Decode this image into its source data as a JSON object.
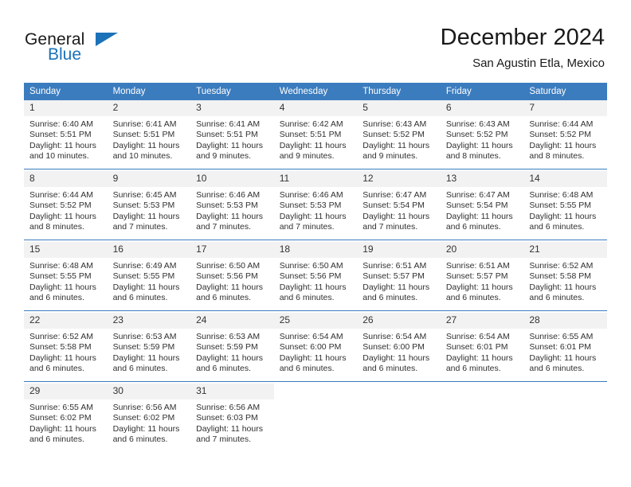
{
  "brand": {
    "word_one": "General",
    "word_two": "Blue",
    "logo_icon": "triangle-flag-icon"
  },
  "header": {
    "month_title": "December 2024",
    "location": "San Agustin Etla, Mexico"
  },
  "colors": {
    "header_blue": "#3b7cbe",
    "brand_blue": "#1b72b8",
    "daynum_bg": "#f2f2f2",
    "text": "#303030"
  },
  "calendar": {
    "weekday_headers": [
      "Sunday",
      "Monday",
      "Tuesday",
      "Wednesday",
      "Thursday",
      "Friday",
      "Saturday"
    ],
    "weeks": [
      [
        {
          "day": "1",
          "sunrise": "Sunrise: 6:40 AM",
          "sunset": "Sunset: 5:51 PM",
          "daylight": "Daylight: 11 hours and 10 minutes."
        },
        {
          "day": "2",
          "sunrise": "Sunrise: 6:41 AM",
          "sunset": "Sunset: 5:51 PM",
          "daylight": "Daylight: 11 hours and 10 minutes."
        },
        {
          "day": "3",
          "sunrise": "Sunrise: 6:41 AM",
          "sunset": "Sunset: 5:51 PM",
          "daylight": "Daylight: 11 hours and 9 minutes."
        },
        {
          "day": "4",
          "sunrise": "Sunrise: 6:42 AM",
          "sunset": "Sunset: 5:51 PM",
          "daylight": "Daylight: 11 hours and 9 minutes."
        },
        {
          "day": "5",
          "sunrise": "Sunrise: 6:43 AM",
          "sunset": "Sunset: 5:52 PM",
          "daylight": "Daylight: 11 hours and 9 minutes."
        },
        {
          "day": "6",
          "sunrise": "Sunrise: 6:43 AM",
          "sunset": "Sunset: 5:52 PM",
          "daylight": "Daylight: 11 hours and 8 minutes."
        },
        {
          "day": "7",
          "sunrise": "Sunrise: 6:44 AM",
          "sunset": "Sunset: 5:52 PM",
          "daylight": "Daylight: 11 hours and 8 minutes."
        }
      ],
      [
        {
          "day": "8",
          "sunrise": "Sunrise: 6:44 AM",
          "sunset": "Sunset: 5:52 PM",
          "daylight": "Daylight: 11 hours and 8 minutes."
        },
        {
          "day": "9",
          "sunrise": "Sunrise: 6:45 AM",
          "sunset": "Sunset: 5:53 PM",
          "daylight": "Daylight: 11 hours and 7 minutes."
        },
        {
          "day": "10",
          "sunrise": "Sunrise: 6:46 AM",
          "sunset": "Sunset: 5:53 PM",
          "daylight": "Daylight: 11 hours and 7 minutes."
        },
        {
          "day": "11",
          "sunrise": "Sunrise: 6:46 AM",
          "sunset": "Sunset: 5:53 PM",
          "daylight": "Daylight: 11 hours and 7 minutes."
        },
        {
          "day": "12",
          "sunrise": "Sunrise: 6:47 AM",
          "sunset": "Sunset: 5:54 PM",
          "daylight": "Daylight: 11 hours and 7 minutes."
        },
        {
          "day": "13",
          "sunrise": "Sunrise: 6:47 AM",
          "sunset": "Sunset: 5:54 PM",
          "daylight": "Daylight: 11 hours and 6 minutes."
        },
        {
          "day": "14",
          "sunrise": "Sunrise: 6:48 AM",
          "sunset": "Sunset: 5:55 PM",
          "daylight": "Daylight: 11 hours and 6 minutes."
        }
      ],
      [
        {
          "day": "15",
          "sunrise": "Sunrise: 6:48 AM",
          "sunset": "Sunset: 5:55 PM",
          "daylight": "Daylight: 11 hours and 6 minutes."
        },
        {
          "day": "16",
          "sunrise": "Sunrise: 6:49 AM",
          "sunset": "Sunset: 5:55 PM",
          "daylight": "Daylight: 11 hours and 6 minutes."
        },
        {
          "day": "17",
          "sunrise": "Sunrise: 6:50 AM",
          "sunset": "Sunset: 5:56 PM",
          "daylight": "Daylight: 11 hours and 6 minutes."
        },
        {
          "day": "18",
          "sunrise": "Sunrise: 6:50 AM",
          "sunset": "Sunset: 5:56 PM",
          "daylight": "Daylight: 11 hours and 6 minutes."
        },
        {
          "day": "19",
          "sunrise": "Sunrise: 6:51 AM",
          "sunset": "Sunset: 5:57 PM",
          "daylight": "Daylight: 11 hours and 6 minutes."
        },
        {
          "day": "20",
          "sunrise": "Sunrise: 6:51 AM",
          "sunset": "Sunset: 5:57 PM",
          "daylight": "Daylight: 11 hours and 6 minutes."
        },
        {
          "day": "21",
          "sunrise": "Sunrise: 6:52 AM",
          "sunset": "Sunset: 5:58 PM",
          "daylight": "Daylight: 11 hours and 6 minutes."
        }
      ],
      [
        {
          "day": "22",
          "sunrise": "Sunrise: 6:52 AM",
          "sunset": "Sunset: 5:58 PM",
          "daylight": "Daylight: 11 hours and 6 minutes."
        },
        {
          "day": "23",
          "sunrise": "Sunrise: 6:53 AM",
          "sunset": "Sunset: 5:59 PM",
          "daylight": "Daylight: 11 hours and 6 minutes."
        },
        {
          "day": "24",
          "sunrise": "Sunrise: 6:53 AM",
          "sunset": "Sunset: 5:59 PM",
          "daylight": "Daylight: 11 hours and 6 minutes."
        },
        {
          "day": "25",
          "sunrise": "Sunrise: 6:54 AM",
          "sunset": "Sunset: 6:00 PM",
          "daylight": "Daylight: 11 hours and 6 minutes."
        },
        {
          "day": "26",
          "sunrise": "Sunrise: 6:54 AM",
          "sunset": "Sunset: 6:00 PM",
          "daylight": "Daylight: 11 hours and 6 minutes."
        },
        {
          "day": "27",
          "sunrise": "Sunrise: 6:54 AM",
          "sunset": "Sunset: 6:01 PM",
          "daylight": "Daylight: 11 hours and 6 minutes."
        },
        {
          "day": "28",
          "sunrise": "Sunrise: 6:55 AM",
          "sunset": "Sunset: 6:01 PM",
          "daylight": "Daylight: 11 hours and 6 minutes."
        }
      ],
      [
        {
          "day": "29",
          "sunrise": "Sunrise: 6:55 AM",
          "sunset": "Sunset: 6:02 PM",
          "daylight": "Daylight: 11 hours and 6 minutes."
        },
        {
          "day": "30",
          "sunrise": "Sunrise: 6:56 AM",
          "sunset": "Sunset: 6:02 PM",
          "daylight": "Daylight: 11 hours and 6 minutes."
        },
        {
          "day": "31",
          "sunrise": "Sunrise: 6:56 AM",
          "sunset": "Sunset: 6:03 PM",
          "daylight": "Daylight: 11 hours and 7 minutes."
        },
        {
          "day": "",
          "sunrise": "",
          "sunset": "",
          "daylight": ""
        },
        {
          "day": "",
          "sunrise": "",
          "sunset": "",
          "daylight": ""
        },
        {
          "day": "",
          "sunrise": "",
          "sunset": "",
          "daylight": ""
        },
        {
          "day": "",
          "sunrise": "",
          "sunset": "",
          "daylight": ""
        }
      ]
    ]
  }
}
